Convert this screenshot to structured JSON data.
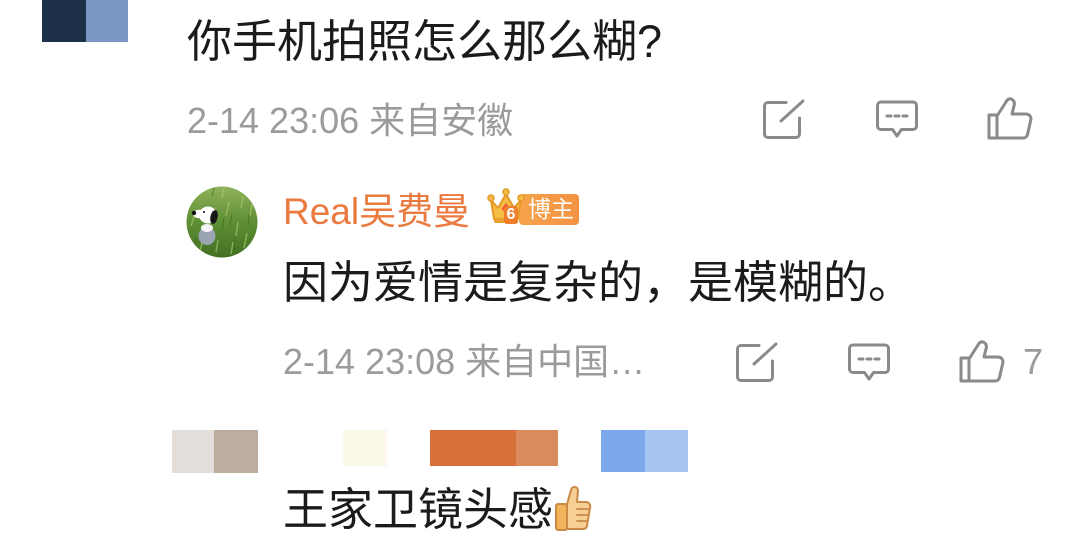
{
  "theme": {
    "text_color": "#1b1b1b",
    "meta_color": "#9b9b9b",
    "icon_color": "#8a8a8a",
    "author_color": "#ea7a3f",
    "badge_color": "#f39343",
    "background": "#ffffff"
  },
  "censored": {
    "first_commenter": [
      "#1d3149",
      "#7b97c5"
    ],
    "third_commenter": [
      "#e3ded9",
      "#bcae9f",
      "#fcf8ea",
      "#d8703a",
      "#d98b5d",
      "#7ea8ec",
      "#a5c4f2"
    ]
  },
  "comment": {
    "text": "你手机拍照怎么那么糊?",
    "time": "2-14 23:06",
    "source": "来自安徽",
    "icons": {
      "share": "share-icon",
      "reply": "comment-icon",
      "like": "like-icon"
    }
  },
  "reply": {
    "avatar": "snoopy-avatar",
    "author": "Real吴费曼",
    "badge_icon": "crown-icon",
    "level": "6",
    "badge": "博主",
    "text": "因为爱情是复杂的，是模糊的。",
    "time": "2-14 23:08",
    "source": "来自中国…",
    "like_count": "7",
    "icons": {
      "share": "share-icon",
      "reply": "comment-icon",
      "like": "like-icon"
    }
  },
  "second_reply": {
    "text": "王家卫镜头感",
    "emoji_icon": "thumbs-up-emoji-icon"
  }
}
